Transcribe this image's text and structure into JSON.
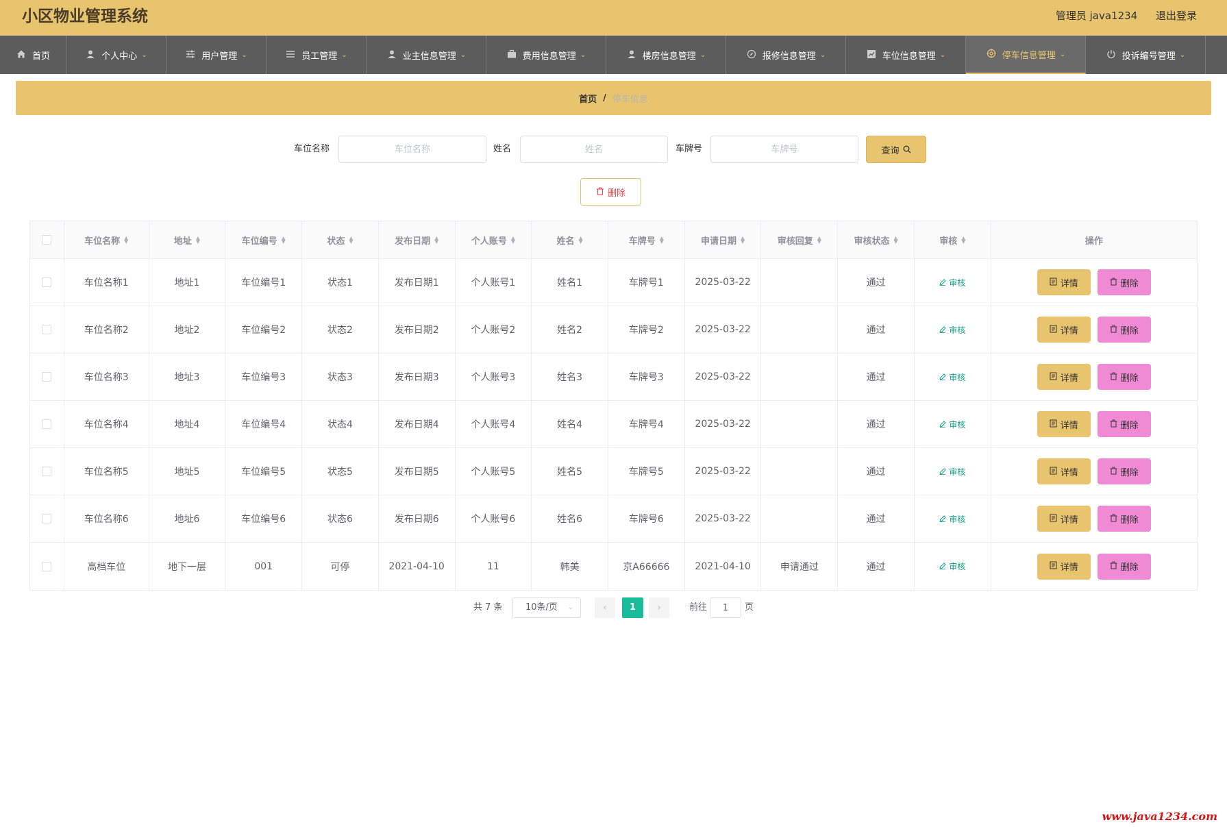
{
  "header": {
    "app_title": "小区物业管理系统",
    "admin_label": "管理员 java1234",
    "logout_label": "退出登录"
  },
  "nav": {
    "items": [
      {
        "label": "首页",
        "icon": "home-icon",
        "caret": false
      },
      {
        "label": "个人中心",
        "icon": "user-icon",
        "caret": true
      },
      {
        "label": "用户管理",
        "icon": "sliders-icon",
        "caret": true
      },
      {
        "label": "员工管理",
        "icon": "list-icon",
        "caret": true
      },
      {
        "label": "业主信息管理",
        "icon": "user-icon",
        "caret": true
      },
      {
        "label": "费用信息管理",
        "icon": "briefcase-icon",
        "caret": true
      },
      {
        "label": "楼房信息管理",
        "icon": "user-icon",
        "caret": true
      },
      {
        "label": "报修信息管理",
        "icon": "compass-icon",
        "caret": true
      },
      {
        "label": "车位信息管理",
        "icon": "chart-icon",
        "caret": true
      },
      {
        "label": "停车信息管理",
        "icon": "target-icon",
        "caret": true,
        "active": true
      },
      {
        "label": "投诉编号管理",
        "icon": "power-icon",
        "caret": true
      }
    ]
  },
  "breadcrumb": {
    "home": "首页",
    "separator": "/",
    "current": "停车信息"
  },
  "search": {
    "space_name_label": "车位名称",
    "space_name_placeholder": "车位名称",
    "name_label": "姓名",
    "name_placeholder": "姓名",
    "plate_label": "车牌号",
    "plate_placeholder": "车牌号",
    "query_label": "查询"
  },
  "toolbar": {
    "delete_label": "删除"
  },
  "table": {
    "columns": [
      "车位名称",
      "地址",
      "车位编号",
      "状态",
      "发布日期",
      "个人账号",
      "姓名",
      "车牌号",
      "申请日期",
      "审核回复",
      "审核状态",
      "审核",
      "操作"
    ],
    "audit_link_label": "审核",
    "detail_label": "详情",
    "delete_label": "删除",
    "rows": [
      [
        "车位名称1",
        "地址1",
        "车位编号1",
        "状态1",
        "发布日期1",
        "个人账号1",
        "姓名1",
        "车牌号1",
        "2025-03-22",
        "",
        "通过"
      ],
      [
        "车位名称2",
        "地址2",
        "车位编号2",
        "状态2",
        "发布日期2",
        "个人账号2",
        "姓名2",
        "车牌号2",
        "2025-03-22",
        "",
        "通过"
      ],
      [
        "车位名称3",
        "地址3",
        "车位编号3",
        "状态3",
        "发布日期3",
        "个人账号3",
        "姓名3",
        "车牌号3",
        "2025-03-22",
        "",
        "通过"
      ],
      [
        "车位名称4",
        "地址4",
        "车位编号4",
        "状态4",
        "发布日期4",
        "个人账号4",
        "姓名4",
        "车牌号4",
        "2025-03-22",
        "",
        "通过"
      ],
      [
        "车位名称5",
        "地址5",
        "车位编号5",
        "状态5",
        "发布日期5",
        "个人账号5",
        "姓名5",
        "车牌号5",
        "2025-03-22",
        "",
        "通过"
      ],
      [
        "车位名称6",
        "地址6",
        "车位编号6",
        "状态6",
        "发布日期6",
        "个人账号6",
        "姓名6",
        "车牌号6",
        "2025-03-22",
        "",
        "通过"
      ],
      [
        "高档车位",
        "地下一层",
        "001",
        "可停",
        "2021-04-10",
        "11",
        "韩美",
        "京A66666",
        "2021-04-10",
        "申请通过",
        "通过"
      ]
    ]
  },
  "pagination": {
    "total_label": "共 7 条",
    "page_size_label": "10条/页",
    "current_page": "1",
    "goto_label": "前往",
    "goto_value": "1",
    "page_suffix": "页"
  },
  "watermark": "www.java1234.com",
  "colors": {
    "header_bg": "#e8c46e",
    "nav_bg": "#5c5c5c",
    "active_page": "#1abc9c",
    "delete_button": "#f08ad4",
    "audit_link": "#16a085"
  }
}
